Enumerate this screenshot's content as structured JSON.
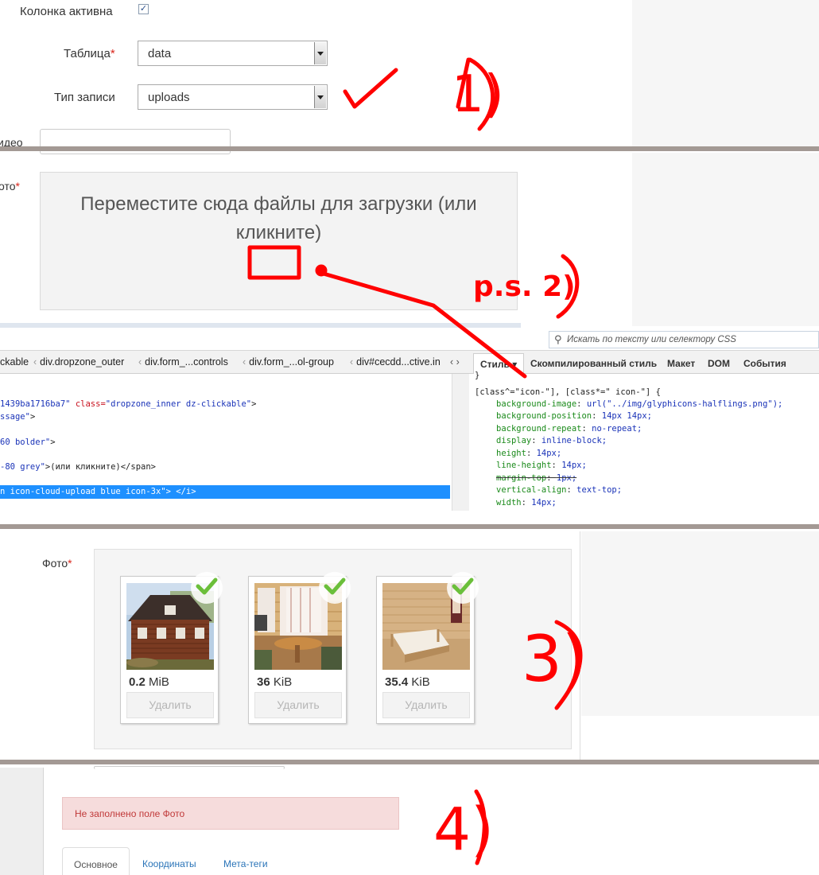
{
  "panel1": {
    "active_label": "Колонка активна",
    "table_label": "Таблица",
    "table_value": "data",
    "type_label": "Тип записи",
    "type_value": "uploads",
    "video_label": "идео",
    "photo_label": "ото",
    "required_mark": "*"
  },
  "dropzone": {
    "message": "Переместите сюда файлы для загрузки (или кликните)"
  },
  "devtools": {
    "search_placeholder": "Искать по тексту или селектору CSS",
    "breadcrumbs": [
      "ckable",
      "div.dropzone_outer",
      "div.form_...controls",
      "div.form_...ol-group",
      "div#cecdd...ctive.in"
    ],
    "tabs": [
      "Стиль",
      "Скомпилированный стиль",
      "Макет",
      "DOM",
      "События"
    ],
    "html_lines": [
      {
        "pre": "1439ba1716ba7\"",
        "attr": " class=",
        "val": "\"dropzone_inner dz-clickable\"",
        "post": ">"
      },
      {
        "pre": "ssage\"",
        "attr": "",
        "val": "",
        "post": ">"
      },
      {
        "pre": "60 bolder\"",
        "attr": "",
        "val": "",
        "post": ">"
      },
      {
        "pre": "-80 grey\"",
        "attr": "",
        "val": "",
        "post": ">(или кликните)</span>"
      }
    ],
    "selected_line": "n icon-cloud-upload blue icon-3x\"> </i>",
    "css_top": "}",
    "css_selector": "[class^=\"icon-\"], [class*=\" icon-\"] {",
    "css_rules": [
      {
        "prop": "background-image",
        "val": "url(\"../img/glyphicons-halflings.png\");",
        "strike": false
      },
      {
        "prop": "background-position",
        "val": "14px 14px;",
        "strike": false
      },
      {
        "prop": "background-repeat",
        "val": "no-repeat;",
        "strike": false
      },
      {
        "prop": "display",
        "val": "inline-block;",
        "strike": false
      },
      {
        "prop": "height",
        "val": "14px;",
        "strike": false
      },
      {
        "prop": "line-height",
        "val": "14px;",
        "strike": false
      },
      {
        "prop": "margin-top",
        "val": "1px;",
        "strike": true
      },
      {
        "prop": "vertical-align",
        "val": "text-top;",
        "strike": false
      },
      {
        "prop": "width",
        "val": "14px;",
        "strike": false
      }
    ]
  },
  "panel3": {
    "photo_label": "Фото",
    "files": [
      {
        "size_num": "0.2",
        "size_unit": "MiB",
        "delete_label": "Удалить"
      },
      {
        "size_num": "36",
        "size_unit": "KiB",
        "delete_label": "Удалить"
      },
      {
        "size_num": "35.4",
        "size_unit": "KiB",
        "delete_label": "Удалить"
      }
    ]
  },
  "panel4": {
    "alert": "Не заполнено поле Фото",
    "tabs": [
      "Основное",
      "Координаты",
      "Мета-теги"
    ]
  },
  "annotations": {
    "step1": "1)",
    "ps2": "p.s. 2)",
    "step3": "3)",
    "step4": "4)"
  },
  "colors": {
    "annotation_red": "#ff0000",
    "separator": "#a39994",
    "selection_blue": "#1e90ff",
    "alert_bg": "#f6dcdc",
    "check_green": "#6bbf3a"
  }
}
